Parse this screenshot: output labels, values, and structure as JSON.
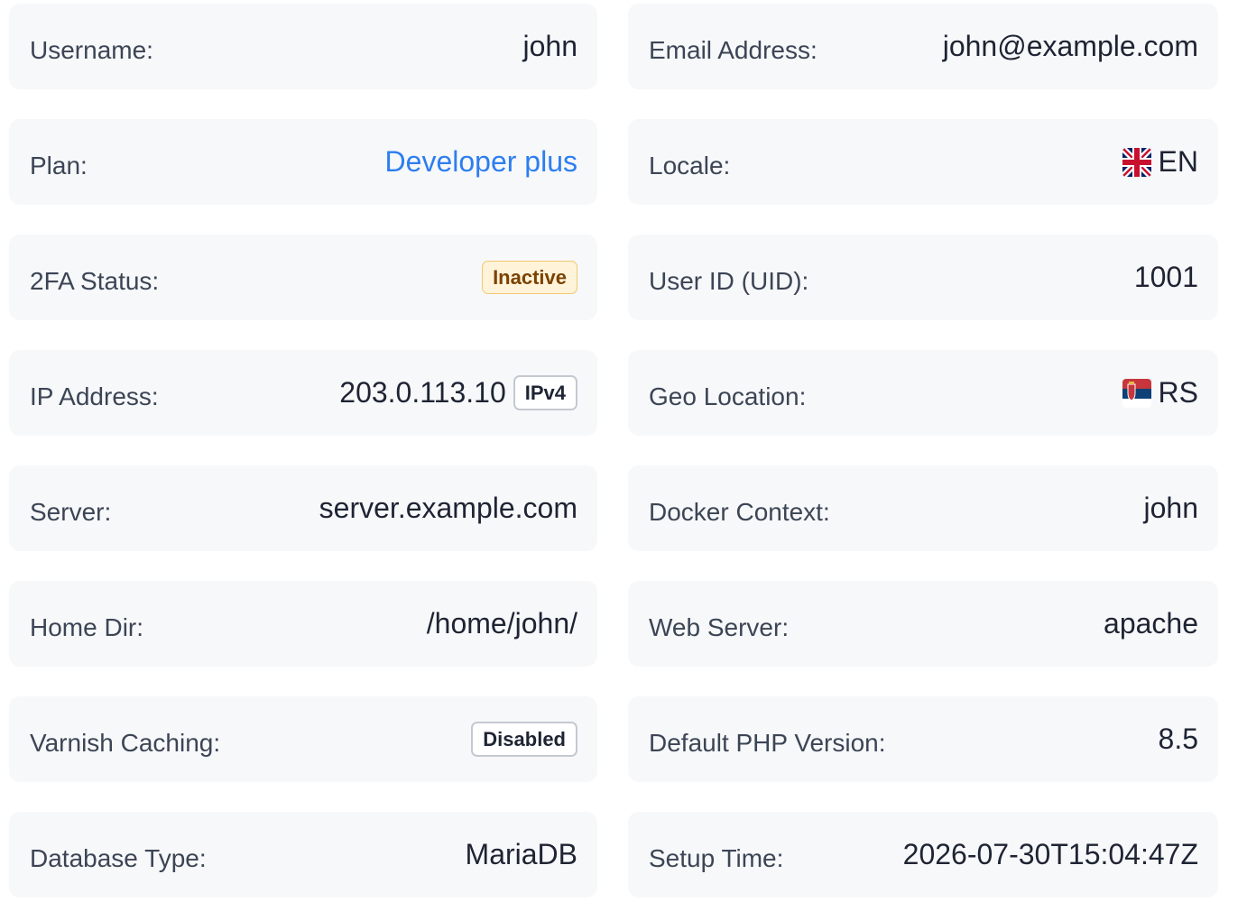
{
  "fields": {
    "username": {
      "label": "Username:",
      "value": "john"
    },
    "email": {
      "label": "Email Address:",
      "value": "john@example.com"
    },
    "plan": {
      "label": "Plan:",
      "value": "Developer plus"
    },
    "locale": {
      "label": "Locale:",
      "value": "EN",
      "flag_icon": "uk-flag-icon"
    },
    "twofa": {
      "label": "2FA Status:",
      "value": "Inactive",
      "badge_color": "#fff3d9"
    },
    "uid": {
      "label": "User ID (UID):",
      "value": "1001"
    },
    "ip": {
      "label": "IP Address:",
      "value": "203.0.113.10",
      "badge": "IPv4"
    },
    "geo": {
      "label": "Geo Location:",
      "value": "RS",
      "flag_icon": "serbia-flag-icon"
    },
    "server": {
      "label": "Server:",
      "value": "server.example.com"
    },
    "docker": {
      "label": "Docker Context:",
      "value": "john"
    },
    "home": {
      "label": "Home Dir:",
      "value": "/home/john/"
    },
    "webserver": {
      "label": "Web Server:",
      "value": "apache"
    },
    "varnish": {
      "label": "Varnish Caching:",
      "value": "Disabled"
    },
    "php": {
      "label": "Default PHP Version:",
      "value": "8.5"
    },
    "db": {
      "label": "Database Type:",
      "value": "MariaDB"
    },
    "setup": {
      "label": "Setup Time:",
      "value": "2026-07-30T15:04:47Z"
    }
  },
  "colors": {
    "link": "#2d7ef0",
    "card_bg": "#f7f8fa",
    "label": "#3c4555",
    "value": "#1e2433"
  }
}
